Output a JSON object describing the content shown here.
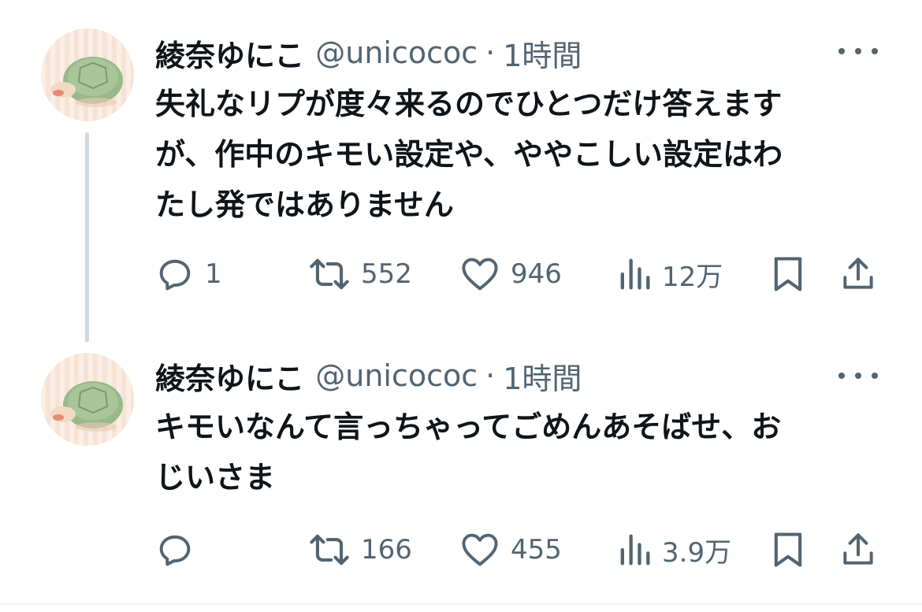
{
  "tweets": [
    {
      "author": {
        "name": "綾奈ゆにこ",
        "handle": "@unicococ"
      },
      "separator": "·",
      "time": "1時間",
      "text_lines": [
        "失礼なリプが度々来るのでひとつだけ答えます",
        "が、作中のキモい設定や、ややこしい設定はわ",
        "たし発ではありません"
      ],
      "stats": {
        "replies": "1",
        "retweets": "552",
        "likes": "946",
        "views": "12万"
      }
    },
    {
      "author": {
        "name": "綾奈ゆにこ",
        "handle": "@unicococ"
      },
      "separator": "·",
      "time": "1時間",
      "text_lines": [
        "キモいなんて言っちゃってごめんあそばせ、お",
        "じいさま"
      ],
      "stats": {
        "replies": "",
        "retweets": "166",
        "likes": "455",
        "views": "3.9万"
      }
    }
  ],
  "colors": {
    "text": "#0f1419",
    "secondary": "#536471",
    "thread_line": "#cfd9de"
  },
  "icons": [
    "reply-icon",
    "retweet-icon",
    "like-icon",
    "views-icon",
    "bookmark-icon",
    "share-icon",
    "more-icon"
  ]
}
